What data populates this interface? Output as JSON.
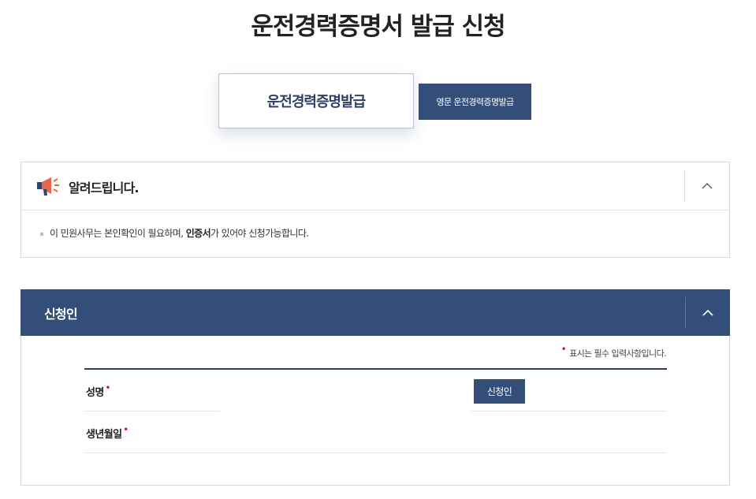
{
  "page": {
    "title": "운전경력증명서 발급 신청"
  },
  "tabs": {
    "main_label": "운전경력증명발급",
    "alt_label": "영문 운전경력증명발급"
  },
  "notice": {
    "title": "알려드립니다.",
    "text_before": "이 민원사무는 본인확인이 필요하며, ",
    "text_bold": "인증서",
    "text_after": "가 있어야 신청가능합니다."
  },
  "applicant": {
    "title": "신청인",
    "required_note": "표시는 필수 입력사항입니다.",
    "required_mark": "•",
    "fields": [
      {
        "label": "성명"
      },
      {
        "label": "생년월일"
      }
    ],
    "button_label": "신청인"
  },
  "colors": {
    "primary": "#344e7a",
    "required": "#d0121b",
    "border": "#d9d9d9"
  },
  "icons": {
    "notice_icon": "megaphone-icon",
    "toggle_icon": "chevron-up-icon"
  }
}
